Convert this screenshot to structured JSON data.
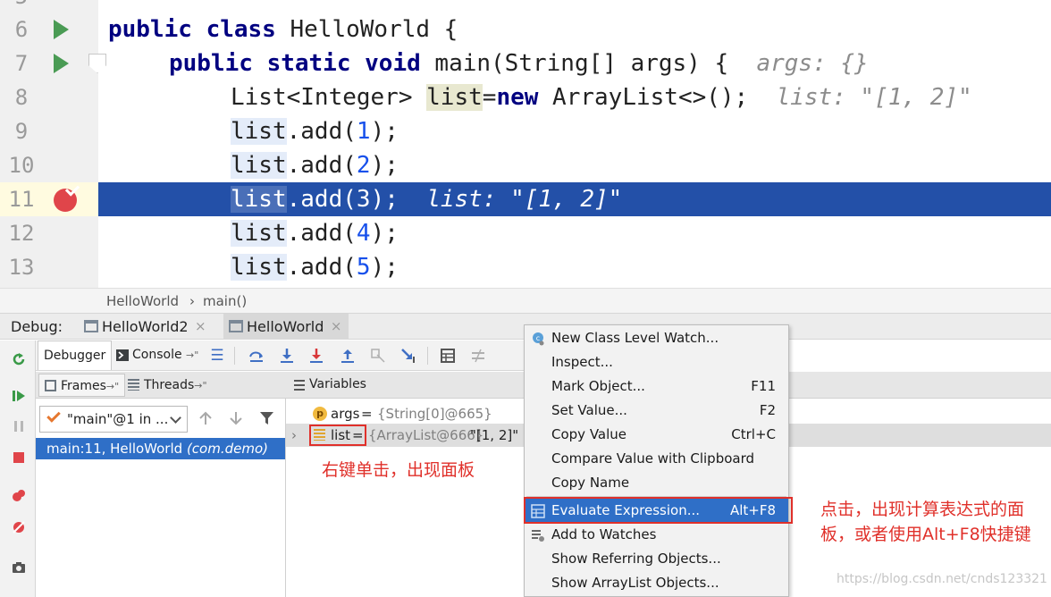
{
  "editor": {
    "lines": [
      {
        "num": "6"
      },
      {
        "num": "7"
      },
      {
        "num": "8"
      },
      {
        "num": "9"
      },
      {
        "num": "10"
      },
      {
        "num": "11"
      },
      {
        "num": "12"
      },
      {
        "num": "13"
      }
    ],
    "code": {
      "l6_kw": "public class",
      "l6_rest": " HelloWorld {",
      "l7_kw": "public static void",
      "l7_rest": " main(String[] args) {  ",
      "l7_hint": "args: {}",
      "l8_a": "List<Integer> ",
      "l8_ref": "list",
      "l8_eq": "=",
      "l8_new": "new",
      "l8_rest": " ArrayList<>();  ",
      "l8_hint": "list: \"[1, 2]\"",
      "ref": "list",
      "add_open": ".add(",
      "close": ");",
      "n1": "1",
      "n2": "2",
      "n3": "3",
      "n4": "4",
      "n5": "5",
      "l11_hint": "list: \"[1, 2]\""
    }
  },
  "breadcrumb": {
    "class_name": "HelloWorld",
    "sep": "›",
    "method": "main()"
  },
  "debug_bar": {
    "label": "Debug:",
    "tabs": [
      {
        "label": "HelloWorld2",
        "close": "×"
      },
      {
        "label": "HelloWorld",
        "close": "×"
      }
    ]
  },
  "debugger_toolbar": {
    "debugger_tab": "Debugger",
    "console_tab": "Console",
    "console_suffix": "→\""
  },
  "frames": {
    "frames_tab": "Frames",
    "threads_tab": "Threads",
    "tab_suffix": "→\"",
    "thread_selected": "\"main\"@1 in ...",
    "frame_main": "main:11, HelloWorld ",
    "frame_pkg": "(com.demo)"
  },
  "variables": {
    "header": "Variables",
    "rows": [
      {
        "name": "args",
        "eq": " = ",
        "value": "{String[0]@665}"
      },
      {
        "name": "list",
        "eq": " = ",
        "value": "{ArrayList@666}",
        "display": " \"[1, 2]\""
      }
    ]
  },
  "context_menu": {
    "items": [
      {
        "label": "New Class Level Watch...",
        "shortcut": ""
      },
      {
        "label": "Inspect...",
        "shortcut": ""
      },
      {
        "label": "Mark Object...",
        "shortcut": "F11"
      },
      {
        "label": "Set Value...",
        "shortcut": "F2"
      },
      {
        "label": "Copy Value",
        "shortcut": "Ctrl+C"
      },
      {
        "label": "Compare Value with Clipboard",
        "shortcut": ""
      },
      {
        "label": "Copy Name",
        "shortcut": ""
      },
      {
        "label": "Evaluate Expression...",
        "shortcut": "Alt+F8"
      },
      {
        "label": "Add to Watches",
        "shortcut": ""
      },
      {
        "label": "Show Referring Objects...",
        "shortcut": ""
      },
      {
        "label": "Show ArrayList Objects...",
        "shortcut": ""
      }
    ]
  },
  "annotations": {
    "right_click": "右键单击，出现面板",
    "evaluate_line1": "点击，出现计算表达式的面",
    "evaluate_line2": "板，或者使用Alt+F8快捷键"
  },
  "watermark": "https://blog.csdn.net/cnds123321",
  "colors": {
    "highlight_line": "#2350a8",
    "selection": "#2f6fc7",
    "annotation_red": "#e0302a",
    "keyword": "#000080",
    "number": "#1750eb"
  }
}
